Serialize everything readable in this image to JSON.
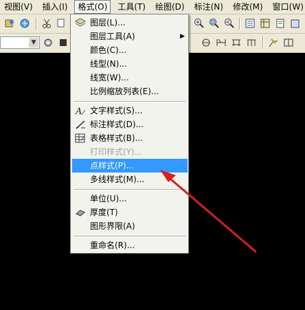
{
  "menubar": {
    "items": [
      {
        "label": "视图(V)"
      },
      {
        "label": "插入(I)"
      },
      {
        "label": "格式(O)",
        "active": true
      },
      {
        "label": "工具(T)"
      },
      {
        "label": "绘图(D)"
      },
      {
        "label": "标注(N)"
      },
      {
        "label": "修改(M)"
      },
      {
        "label": "窗口(W)"
      }
    ]
  },
  "format_menu": {
    "items": [
      {
        "label": "图层(L)...",
        "icon": "layers-icon"
      },
      {
        "label": "图层工具(A)",
        "submenu": true
      },
      {
        "label": "颜色(C)..."
      },
      {
        "label": "线型(N)..."
      },
      {
        "label": "线宽(W)..."
      },
      {
        "label": "比例缩放列表(E)..."
      },
      {
        "label": "文字样式(S)...",
        "icon": "text-style-icon"
      },
      {
        "label": "标注样式(D)...",
        "icon": "dimension-style-icon"
      },
      {
        "label": "表格样式(B)...",
        "icon": "table-style-icon"
      },
      {
        "label": "打印样式(Y)...",
        "disabled": true
      },
      {
        "label": "点样式(P)...",
        "highlighted": true
      },
      {
        "label": "多线样式(M)..."
      },
      {
        "label": "单位(U)..."
      },
      {
        "label": "厚度(T)",
        "icon": "thickness-icon"
      },
      {
        "label": "图形界限(A)"
      },
      {
        "label": "重命名(R)..."
      }
    ],
    "submenu_arrow": "▶"
  },
  "colors": {
    "menu_highlight": "#3399ff",
    "annotation_arrow": "#d42020",
    "canvas": "#000000"
  }
}
